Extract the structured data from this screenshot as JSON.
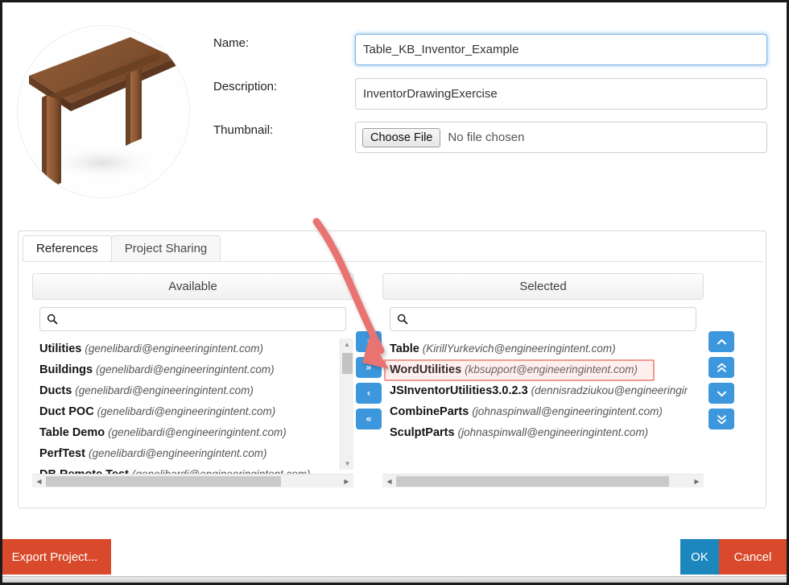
{
  "form": {
    "name_label": "Name:",
    "description_label": "Description:",
    "thumbnail_label": "Thumbnail:",
    "name_value": "Table_KB_Inventor_Example",
    "description_value": "InventorDrawingExercise",
    "choose_file_label": "Choose File",
    "no_file_text": "No file chosen",
    "thumbnail_alt": "wooden-table-thumbnail"
  },
  "tabs": [
    {
      "label": "References",
      "active": true
    },
    {
      "label": "Project Sharing",
      "active": false
    }
  ],
  "available": {
    "header": "Available",
    "search_placeholder": "",
    "search_value": "",
    "search_icon": "search-icon",
    "items": [
      {
        "name": "Utilities",
        "owner": "(genelibardi@engineeringintent.com)"
      },
      {
        "name": "Buildings",
        "owner": "(genelibardi@engineeringintent.com)"
      },
      {
        "name": "Ducts",
        "owner": "(genelibardi@engineeringintent.com)"
      },
      {
        "name": "Duct POC",
        "owner": "(genelibardi@engineeringintent.com)"
      },
      {
        "name": "Table Demo",
        "owner": "(genelibardi@engineeringintent.com)"
      },
      {
        "name": "PerfTest",
        "owner": "(genelibardi@engineeringintent.com)"
      },
      {
        "name": "DB Remote Test",
        "owner": "(genelibardi@engineeringintent.com)"
      }
    ]
  },
  "selected": {
    "header": "Selected",
    "search_placeholder": "",
    "search_value": "",
    "search_icon": "search-icon",
    "highlighted_index": 1,
    "items": [
      {
        "name": "Table",
        "owner": "(KirillYurkevich@engineeringintent.com)"
      },
      {
        "name": "WordUtilities",
        "owner": "(kbsupport@engineeringintent.com)"
      },
      {
        "name": "JSInventorUtilities3.0.2.3",
        "owner": "(dennisradziukou@engineeringintent.co"
      },
      {
        "name": "CombineParts",
        "owner": "(johnaspinwall@engineeringintent.com)"
      },
      {
        "name": "SculptParts",
        "owner": "(johnaspinwall@engineeringintent.com)"
      }
    ]
  },
  "transfer_buttons": [
    {
      "glyph": "›",
      "name": "move-right-button"
    },
    {
      "glyph": "»",
      "name": "move-all-right-button"
    },
    {
      "glyph": "‹",
      "name": "move-left-button"
    },
    {
      "glyph": "«",
      "name": "move-all-left-button"
    }
  ],
  "reorder_buttons": [
    {
      "glyph": "˄",
      "name": "move-up-button"
    },
    {
      "glyph": "«",
      "name": "move-to-top-button"
    },
    {
      "glyph": "˅",
      "name": "move-down-button"
    },
    {
      "glyph": "»",
      "name": "move-to-bottom-button"
    }
  ],
  "footer": {
    "export_label": "Export Project...",
    "ok_label": "OK",
    "cancel_label": "Cancel"
  },
  "annotation": {
    "type": "curved-arrow",
    "color": "#e8736f",
    "points_to": "WordUtilities"
  },
  "colors": {
    "accent_blue": "#3d97dd",
    "ok_blue": "#1b87bd",
    "danger_red": "#d9492b",
    "highlight_red": "#ef9b90",
    "annotation_red": "#e8736f"
  }
}
